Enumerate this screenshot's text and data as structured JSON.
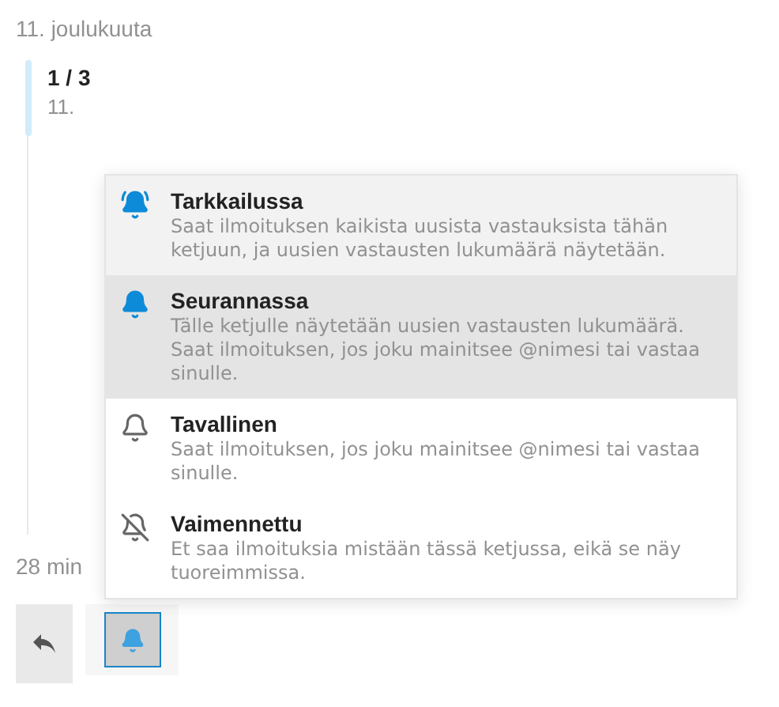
{
  "date_heading": "11. joulukuuta",
  "timeline": {
    "position": "1 / 3",
    "date": "11."
  },
  "time_ago": "28 min",
  "notification_menu": [
    {
      "kind": "watching",
      "title": "Tarkkailussa",
      "description": "Saat ilmoituksen kaikista uusista vastauksista tähän ketjuun, ja uusien vastausten lukumäärä näytetään.",
      "selected": false,
      "hovered": true
    },
    {
      "kind": "tracking",
      "title": "Seurannassa",
      "description": "Tälle ketjulle näytetään uusien vastausten lukumäärä. Saat ilmoituksen, jos joku mainitsee @nimesi tai vastaa sinulle.",
      "selected": true,
      "hovered": false
    },
    {
      "kind": "regular",
      "title": "Tavallinen",
      "description": "Saat ilmoituksen, jos joku mainitsee @nimesi tai vastaa sinulle.",
      "selected": false,
      "hovered": false
    },
    {
      "kind": "muted",
      "title": "Vaimennettu",
      "description": "Et saa ilmoituksia mistään tässä ketjussa, eikä se näy tuoreimmissa.",
      "selected": false,
      "hovered": false
    }
  ]
}
